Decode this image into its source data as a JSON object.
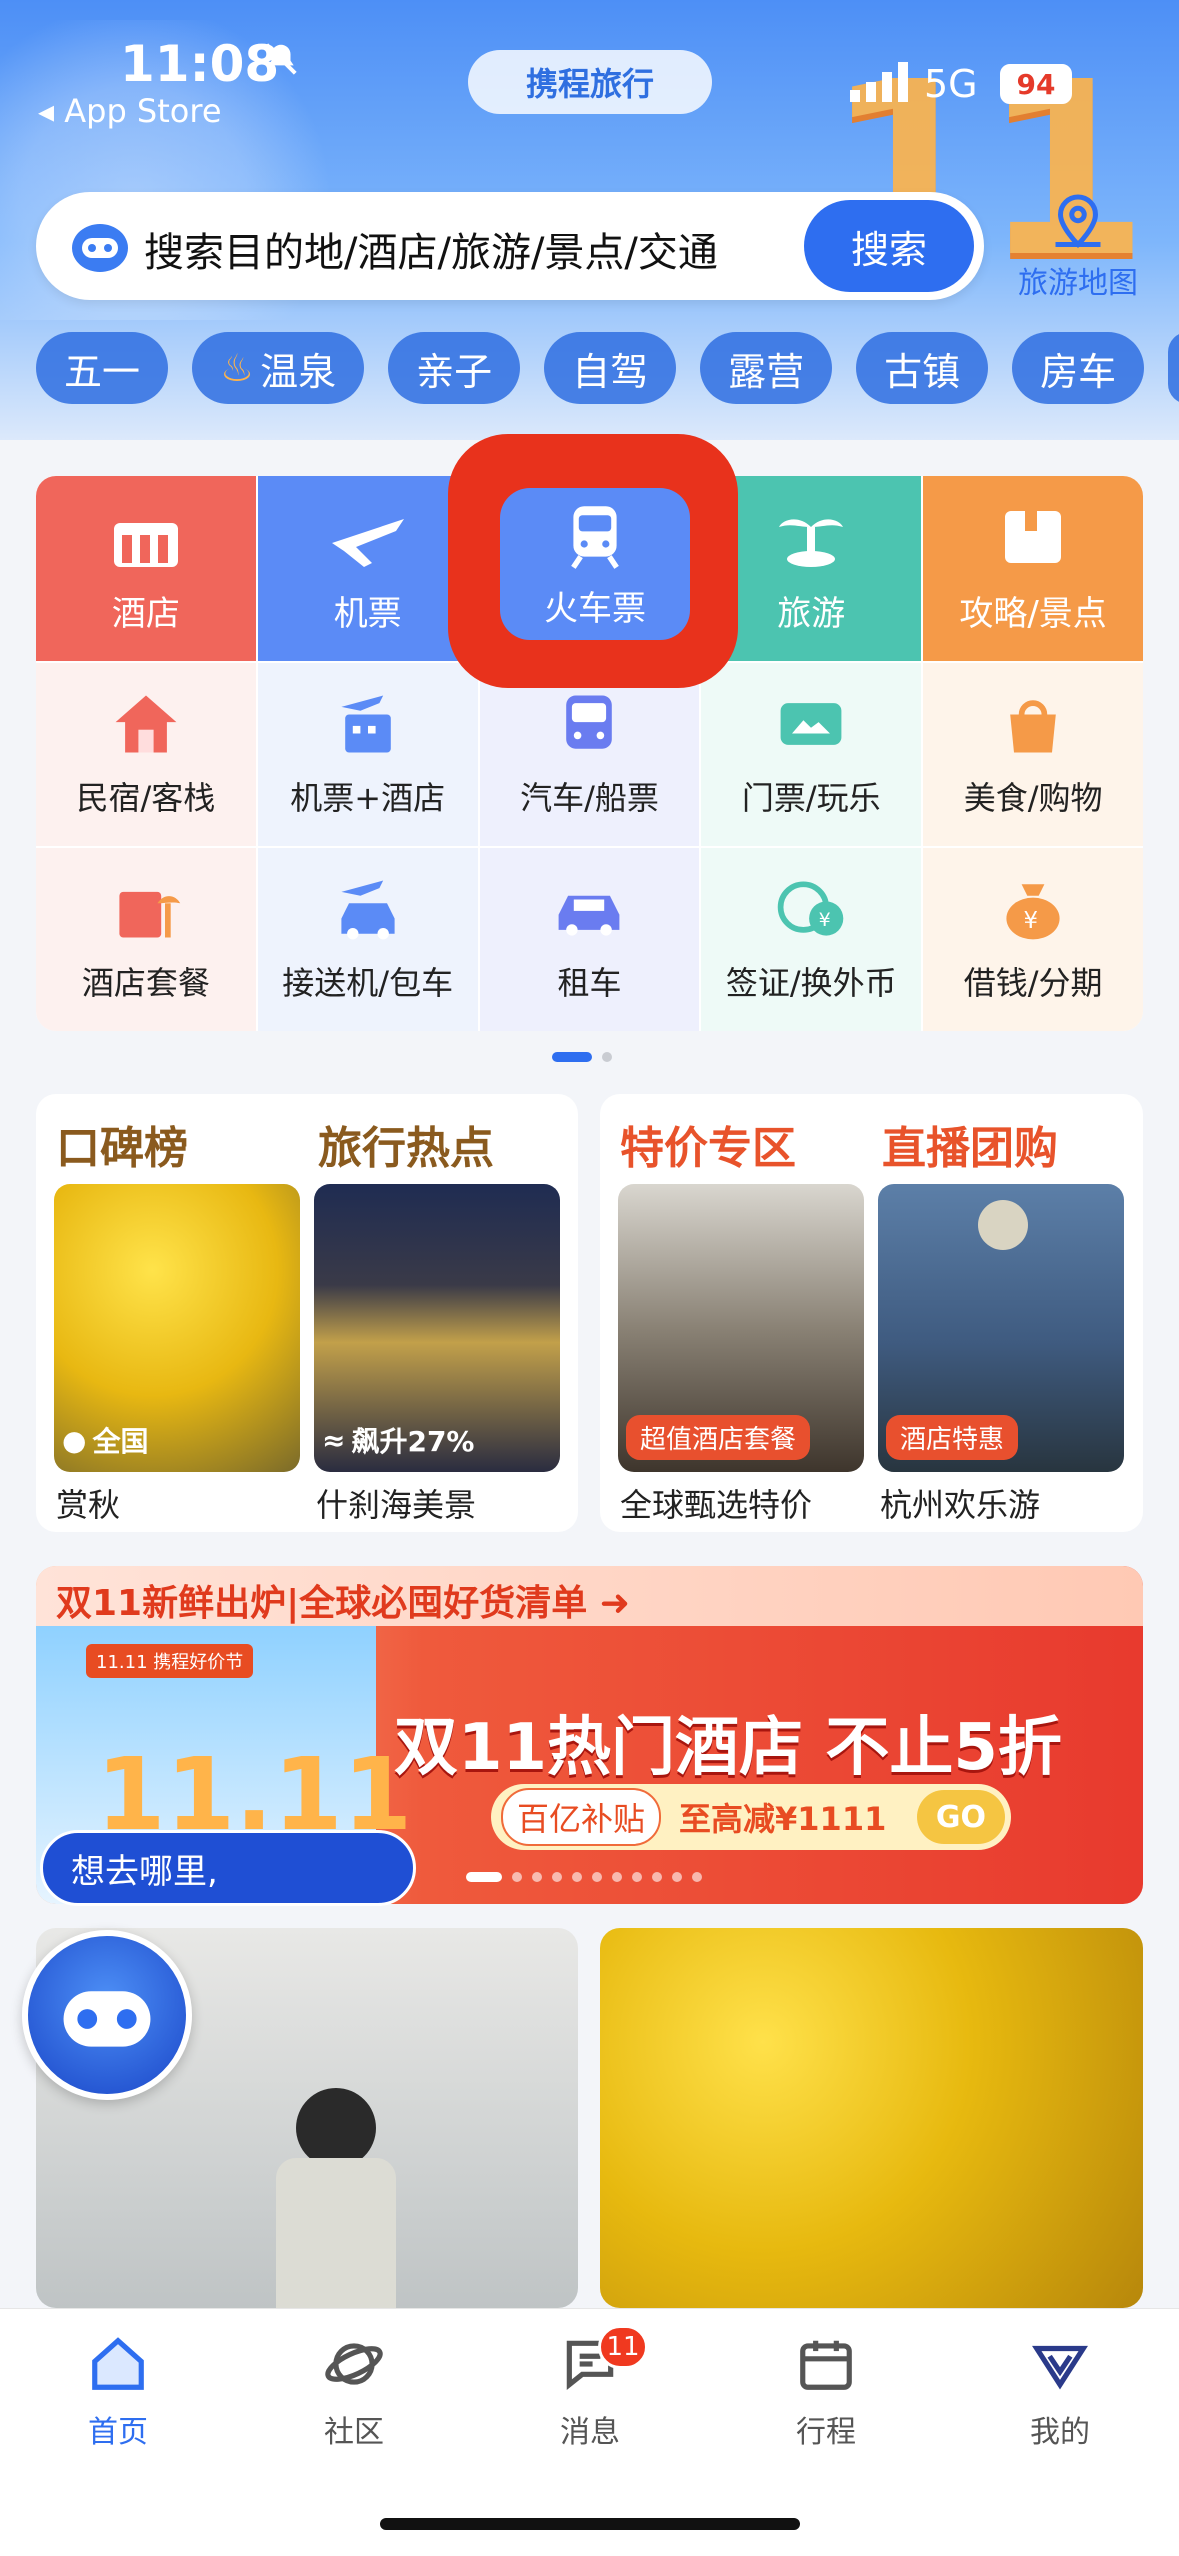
{
  "status": {
    "time": "11:08",
    "back_app": "App Store",
    "brand": "携程旅行",
    "network": "5G",
    "battery": "94"
  },
  "search": {
    "placeholder": "搜索目的地/酒店/旅游/景点/交通",
    "button": "搜索"
  },
  "map_button": "旅游地图",
  "chips": [
    "五一",
    "温泉",
    "亲子",
    "自驾",
    "露营",
    "古镇",
    "房车"
  ],
  "main_tiles": [
    {
      "label": "酒店",
      "color": "#f0665b"
    },
    {
      "label": "机票",
      "color": "#5b8bf6"
    },
    {
      "label": "火车票",
      "color": "#5b8bf6"
    },
    {
      "label": "旅游",
      "color": "#4cc4b0"
    },
    {
      "label": "攻略/景点",
      "color": "#f59a48"
    }
  ],
  "sub_tiles_row1": [
    "民宿/客栈",
    "机票+酒店",
    "汽车/船票",
    "门票/玩乐",
    "美食/购物"
  ],
  "sub_tiles_row2": [
    "酒店套餐",
    "接送机/包车",
    "租车",
    "签证/换外币",
    "借钱/分期"
  ],
  "rank_left": {
    "title1": "口碑榜",
    "title2": "旅行热点",
    "item1": {
      "tag": "全国",
      "caption": "赏秋"
    },
    "item2": {
      "tag": "飙升27%",
      "caption": "什刹海美景"
    }
  },
  "rank_right": {
    "title1": "特价专区",
    "title2": "直播团购",
    "item1": {
      "tag": "超值酒店套餐",
      "caption": "全球甄选特价"
    },
    "item2": {
      "tag": "酒店特惠",
      "caption": "杭州欢乐游"
    }
  },
  "banner": {
    "strip": "双11新鲜出炉|全球必囤好货清单",
    "logo": "11.11 携程好价节",
    "headline": "双11热门酒店 不止5折",
    "pill1": "百亿补贴",
    "pill2": "至高减¥1111",
    "go": "GO"
  },
  "assistant_bubble": "想去哪里,",
  "tabs": [
    {
      "label": "首页",
      "icon": "home-icon"
    },
    {
      "label": "社区",
      "icon": "planet-icon"
    },
    {
      "label": "消息",
      "icon": "message-icon",
      "badge": "11"
    },
    {
      "label": "行程",
      "icon": "calendar-icon"
    },
    {
      "label": "我的",
      "icon": "profile-icon"
    }
  ],
  "colors": {
    "accent": "#2e6ef0",
    "highlight": "#e8321c"
  }
}
